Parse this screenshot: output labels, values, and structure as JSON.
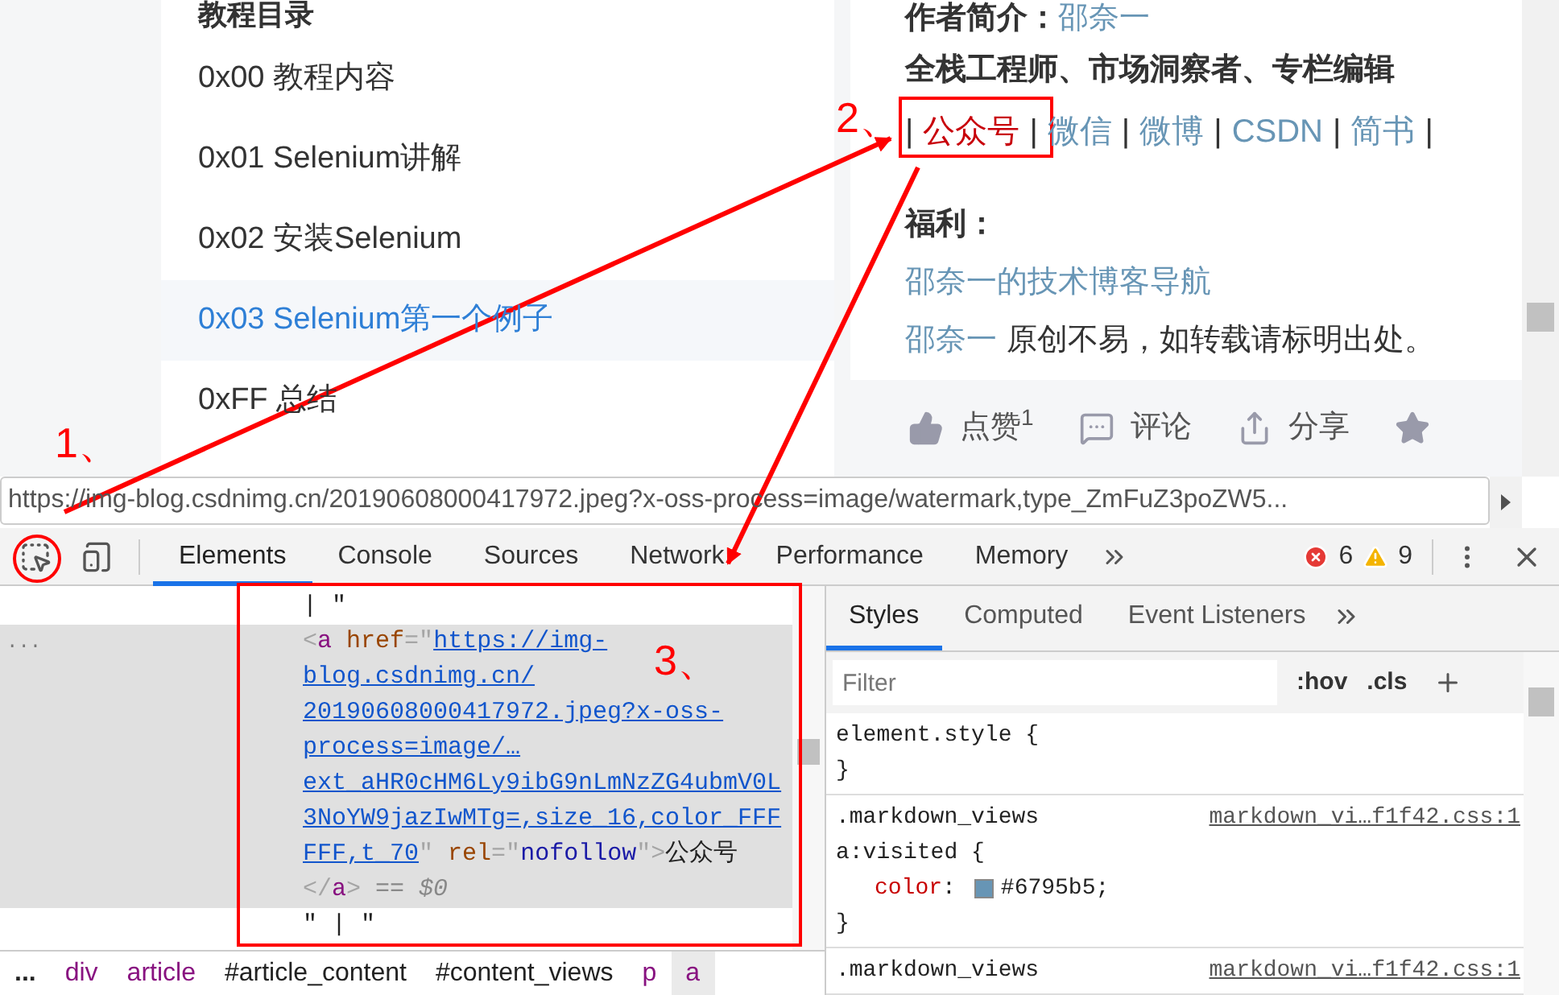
{
  "page": {
    "toc": {
      "title": "教程目录",
      "items": [
        {
          "label": "0x00 教程内容",
          "selected": false
        },
        {
          "label": "0x01 Selenium讲解",
          "selected": false
        },
        {
          "label": "0x02 安装Selenium",
          "selected": false
        },
        {
          "label": "0x03 Selenium第一个例子",
          "selected": true
        },
        {
          "label": "0xFF 总结",
          "selected": false
        }
      ]
    },
    "author": {
      "heading": "作者简介：",
      "name": "邵奈一",
      "roles": "全栈工程师、市场洞察者、专栏编辑",
      "separator": "|",
      "links": [
        "公众号",
        "微信",
        "微博",
        "CSDN",
        "简书"
      ],
      "perks_heading": "福利：",
      "perk_link": "邵奈一的技术博客导航",
      "credit_name": "邵奈一",
      "credit_text": "原创不易，如转载请标明出处。"
    },
    "actions": [
      {
        "kind": "like",
        "label": "点赞",
        "count": "1"
      },
      {
        "kind": "comment",
        "label": "评论"
      },
      {
        "kind": "share",
        "label": "分享"
      },
      {
        "kind": "star"
      }
    ]
  },
  "status_url": "https://img-blog.csdnimg.cn/20190608000417972.jpeg?x-oss-process=image/watermark,type_ZmFuZ3poZW5...",
  "devtools": {
    "tabs": [
      {
        "label": "Elements",
        "selected": true
      },
      {
        "label": "Console",
        "selected": false
      },
      {
        "label": "Sources",
        "selected": false
      },
      {
        "label": "Network",
        "selected": false
      },
      {
        "label": "Performance",
        "selected": false
      },
      {
        "label": "Memory",
        "selected": false
      }
    ],
    "errors": "6",
    "warnings": "9",
    "nodes": [
      {
        "selected": false,
        "lines": [
          [
            {
              "kind": "text",
              "text": "| \""
            }
          ]
        ]
      },
      {
        "selected": true,
        "gutter": "...",
        "lines": [
          [
            {
              "kind": "punct",
              "text": "<"
            },
            {
              "kind": "tag",
              "text": "a"
            },
            {
              "kind": "attr",
              "text": " href"
            },
            {
              "kind": "punct",
              "text": "=\""
            },
            {
              "kind": "link",
              "text": "https://img-"
            }
          ],
          [
            {
              "kind": "link",
              "text": "blog.csdnimg.cn/"
            }
          ],
          [
            {
              "kind": "link",
              "text": "20190608000417972.jpeg?x-oss-"
            }
          ],
          [
            {
              "kind": "link",
              "text": "process=image/…"
            }
          ],
          [
            {
              "kind": "link",
              "text": "ext_aHR0cHM6Ly9ibG9nLmNzZG4ubmV0L"
            }
          ],
          [
            {
              "kind": "link",
              "text": "3NoYW9jazIwMTg=,size_16,color_FFF"
            }
          ],
          [
            {
              "kind": "link",
              "text": "FFF,t_70"
            },
            {
              "kind": "punct",
              "text": "\""
            },
            {
              "kind": "attr",
              "text": " rel"
            },
            {
              "kind": "punct",
              "text": "=\""
            },
            {
              "kind": "value",
              "text": "nofollow"
            },
            {
              "kind": "punct",
              "text": "\">"
            },
            {
              "kind": "text",
              "text": "公众号"
            }
          ],
          [
            {
              "kind": "punct",
              "text": "</"
            },
            {
              "kind": "tag",
              "text": "a"
            },
            {
              "kind": "punct",
              "text": ">"
            },
            {
              "kind": "hint",
              "text": " == $0"
            }
          ]
        ]
      },
      {
        "selected": false,
        "lines": [
          [
            {
              "kind": "text",
              "text": "\" | \""
            }
          ]
        ]
      }
    ],
    "breadcrumb": [
      {
        "kind": "more",
        "label": "...",
        "selected": false
      },
      {
        "kind": "tag",
        "label": "div",
        "selected": false
      },
      {
        "kind": "tag",
        "label": "article",
        "selected": false
      },
      {
        "kind": "id",
        "label": "#article_content",
        "selected": false
      },
      {
        "kind": "id",
        "label": "#content_views",
        "selected": false
      },
      {
        "kind": "tag",
        "label": "p",
        "selected": false
      },
      {
        "kind": "tag",
        "label": "a",
        "selected": true
      }
    ],
    "styles_tabs": [
      {
        "label": "Styles",
        "selected": true
      },
      {
        "label": "Computed",
        "selected": false
      },
      {
        "label": "Event Listeners",
        "selected": false
      }
    ],
    "filter": {
      "placeholder": "Filter"
    },
    "hov": ":hov",
    "cls": ".cls",
    "rules": [
      {
        "selector_lines": [
          "element.style {"
        ],
        "closing": "}"
      },
      {
        "selector_lines": [
          ".markdown_views",
          "a:visited {"
        ],
        "source": "markdown_vi…f1f42.css:1",
        "declarations": [
          {
            "property": "color",
            "colon": ":",
            "value": "#6795b5",
            "terminator": ";"
          }
        ],
        "closing": "}"
      },
      {
        "selector_lines": [
          ".markdown_views"
        ],
        "source": "markdown_vi…f1f42.css:1"
      }
    ]
  },
  "annotations": [
    {
      "label": "1、"
    },
    {
      "label": "2、"
    },
    {
      "label": "3、"
    }
  ]
}
